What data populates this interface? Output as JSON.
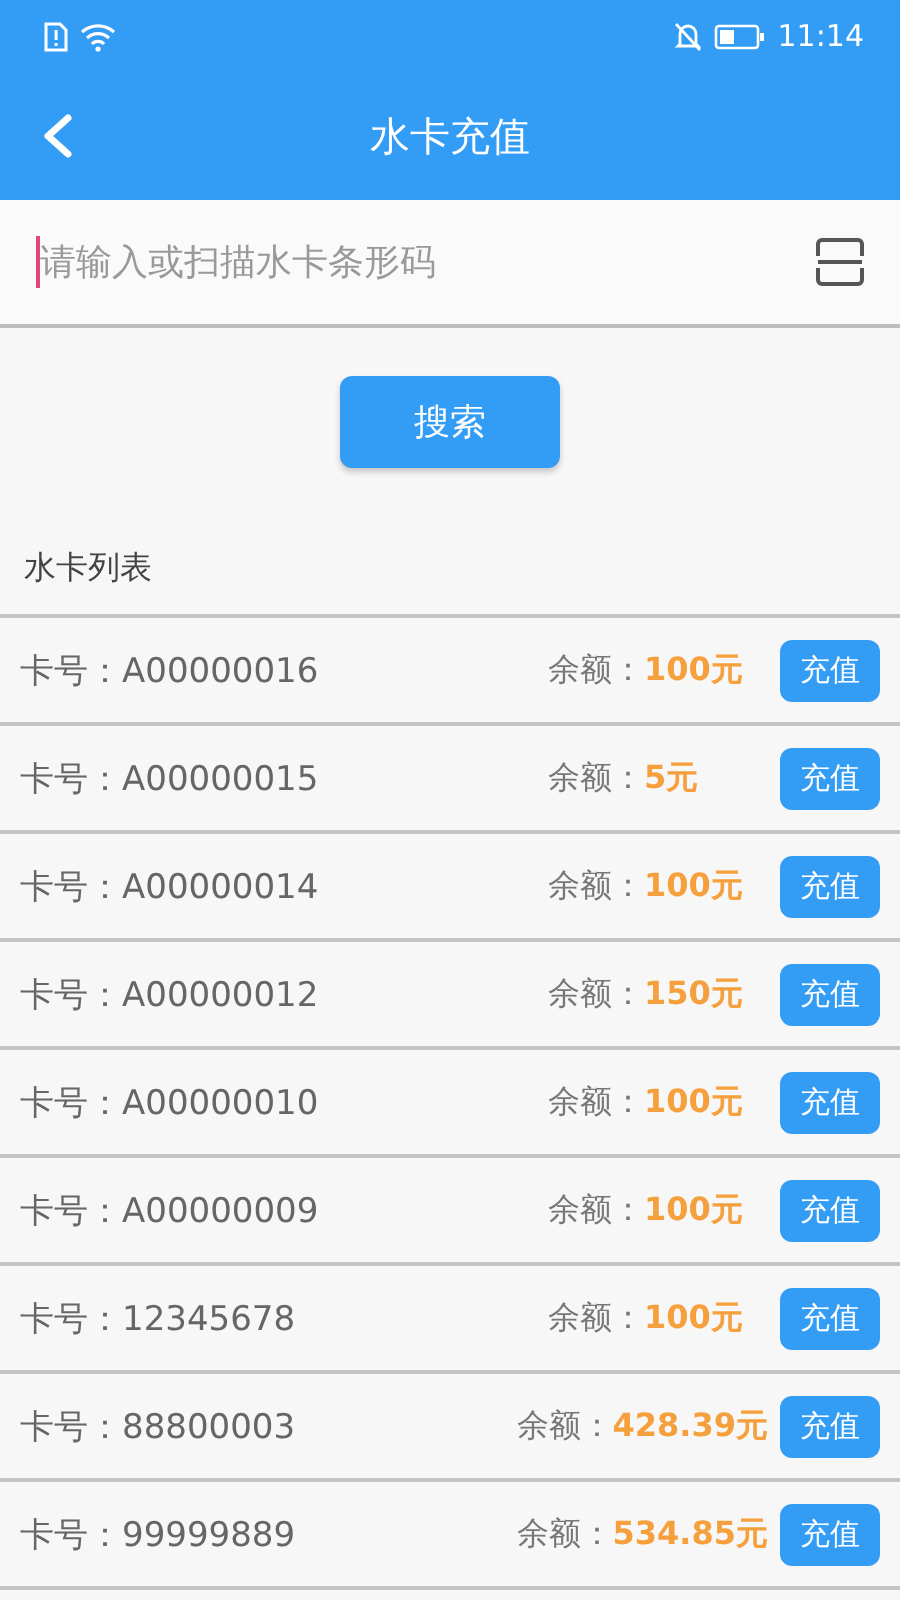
{
  "status_bar": {
    "time": "11:14"
  },
  "app_bar": {
    "title": "水卡充值"
  },
  "search": {
    "placeholder": "请输入或扫描水卡条形码",
    "button": "搜索"
  },
  "list": {
    "title": "水卡列表",
    "rows": [
      {
        "card": "卡号：A00000016",
        "balance_label": "余额：",
        "balance": "100元",
        "action": "充值"
      },
      {
        "card": "卡号：A00000015",
        "balance_label": "余额：",
        "balance": "5元",
        "action": "充值"
      },
      {
        "card": "卡号：A00000014",
        "balance_label": "余额：",
        "balance": "100元",
        "action": "充值"
      },
      {
        "card": "卡号：A00000012",
        "balance_label": "余额：",
        "balance": "150元",
        "action": "充值"
      },
      {
        "card": "卡号：A00000010",
        "balance_label": "余额：",
        "balance": "100元",
        "action": "充值"
      },
      {
        "card": "卡号：A00000009",
        "balance_label": "余额：",
        "balance": "100元",
        "action": "充值"
      },
      {
        "card": "卡号：12345678",
        "balance_label": "余额：",
        "balance": "100元",
        "action": "充值"
      },
      {
        "card": "卡号：88800003",
        "balance_label": "余额：",
        "balance": "428.39元",
        "action": "充值"
      },
      {
        "card": "卡号：99999889",
        "balance_label": "余额：",
        "balance": "534.85元",
        "action": "充值"
      }
    ]
  }
}
